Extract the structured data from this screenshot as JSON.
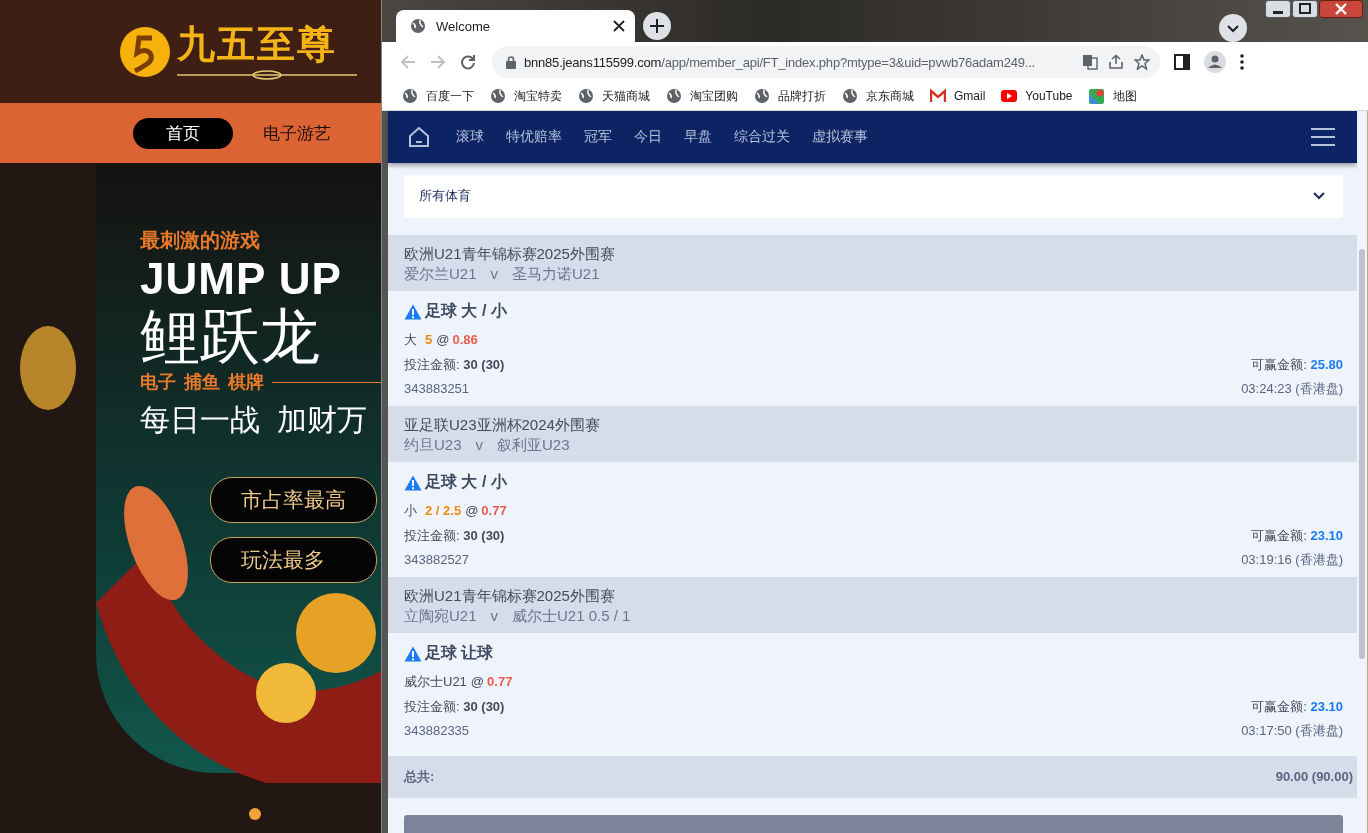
{
  "background_site": {
    "logo_text": "九五至尊",
    "nav": [
      {
        "label": "首页",
        "selected": true
      },
      {
        "label": "电子游艺",
        "selected": false
      }
    ],
    "banner": {
      "tagline": "最刺激的游戏",
      "headline": "JUMP UP",
      "title": "鲤跃龙",
      "categories": [
        "电子",
        "捕鱼",
        "棋牌"
      ],
      "slogan": "每日一战  加财万",
      "buttons": [
        "市占率最高",
        "玩法最多"
      ]
    }
  },
  "browser": {
    "tabs": [
      {
        "title": "Welcome",
        "selected": true
      }
    ],
    "url": "bnn85.jeans115599.com/app/member_api/FT_index.php?mtype=3&uid=pvwb76adam249...",
    "bookmarks": [
      {
        "label": "百度一下",
        "kind": "globe"
      },
      {
        "label": "淘宝特卖",
        "kind": "globe"
      },
      {
        "label": "天猫商城",
        "kind": "globe"
      },
      {
        "label": "淘宝团购",
        "kind": "globe"
      },
      {
        "label": "品牌打折",
        "kind": "globe"
      },
      {
        "label": "京东商城",
        "kind": "globe"
      },
      {
        "label": "Gmail",
        "kind": "mail"
      },
      {
        "label": "YouTube",
        "kind": "video"
      },
      {
        "label": "地图",
        "kind": "map"
      }
    ]
  },
  "app": {
    "nav": [
      {
        "label": "滚球"
      },
      {
        "label": "特优赔率"
      },
      {
        "label": "冠军"
      },
      {
        "label": "今日"
      },
      {
        "label": "早盘"
      },
      {
        "label": "综合过关"
      },
      {
        "label": "虚拟赛事"
      }
    ],
    "sport_filter": "所有体育",
    "bets": [
      {
        "league": "欧洲U21青年锦标赛2025外围赛",
        "home": "爱尔兰U21",
        "vs": "v",
        "away": "圣马力诺U21",
        "market": "足球 大 / 小",
        "selection": "大",
        "line": "5",
        "at": "@",
        "odds": "0.86",
        "stake_label": "投注金额:",
        "stake": "30 (30)",
        "win_label": "可赢金额:",
        "win": "25.80",
        "ticket": "343883251",
        "time": "03:24:23 (香港盘)"
      },
      {
        "league": "亚足联U23亚洲杯2024外围赛",
        "home": "约旦U23",
        "vs": "v",
        "away": "叙利亚U23",
        "market": "足球 大 / 小",
        "selection": "小",
        "line": "2 / 2.5",
        "at": "@",
        "odds": "0.77",
        "stake_label": "投注金额:",
        "stake": "30 (30)",
        "win_label": "可赢金额:",
        "win": "23.10",
        "ticket": "343882527",
        "time": "03:19:16 (香港盘)"
      },
      {
        "league": "欧洲U21青年锦标赛2025外围赛",
        "home": "立陶宛U21",
        "vs": "v",
        "away": "威尔士U21 0.5 / 1",
        "market": "足球 让球",
        "selection": "威尔士U21",
        "at": "@",
        "odds": "0.77",
        "stake_label": "投注金额:",
        "stake": "30 (30)",
        "win_label": "可赢金额:",
        "win": "23.10",
        "ticket": "343882335",
        "time": "03:17:50 (香港盘)"
      }
    ],
    "total_label": "总共:",
    "total": "90.00 (90.00)"
  }
}
